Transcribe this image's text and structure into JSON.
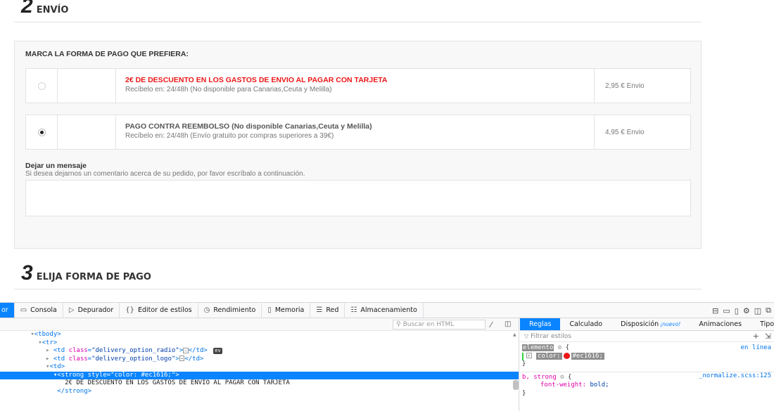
{
  "step2": {
    "number": "2",
    "title": "ENVÍO"
  },
  "shipping": {
    "heading": "MARCA LA FORMA DE PAGO QUE PREFIERA:",
    "options": [
      {
        "title": "2€ DE DESCUENTO EN LOS GASTOS DE ENVIO AL PAGAR CON TARJETA",
        "desc": "Recíbelo en: 24/48h (No disponible para Canarias,Ceuta y Melilla)",
        "price": "2,95 € Envio",
        "selected": false
      },
      {
        "title": "PAGO CONTRA REEMBOLSO (No disponible Canarias,Ceuta y Melilla)",
        "desc": "Recíbelo en: 24/48h (Envío gratuito por compras superiores a 39€)",
        "price": "4,95 € Envio",
        "selected": true
      }
    ],
    "message_label": "Dejar un mensaje",
    "message_help": "Si desea dejarnos un comentario acerca de su pedido, por favor escríbalo a continuación.",
    "message_value": ""
  },
  "step3": {
    "number": "3",
    "title": "ELIJA FORMA DE PAGO"
  },
  "devtools": {
    "tabs": [
      {
        "label": "or",
        "icon": "inspector-icon",
        "glyph": "",
        "active": true
      },
      {
        "label": "Consola",
        "icon": "console-icon",
        "glyph": "▭",
        "active": false
      },
      {
        "label": "Depurador",
        "icon": "debugger-icon",
        "glyph": "▷",
        "active": false
      },
      {
        "label": "Editor de estilos",
        "icon": "style-editor-icon",
        "glyph": "{}",
        "active": false
      },
      {
        "label": "Rendimiento",
        "icon": "performance-icon",
        "glyph": "◷",
        "active": false
      },
      {
        "label": "Memoria",
        "icon": "memory-icon",
        "glyph": "▯",
        "active": false
      },
      {
        "label": "Red",
        "icon": "network-icon",
        "glyph": "☰",
        "active": false
      },
      {
        "label": "Almacenamiento",
        "icon": "storage-icon",
        "glyph": "☷",
        "active": false
      }
    ],
    "search_placeholder": "Buscar en HTML",
    "markup_lines": [
      {
        "indent": "        ",
        "html": "<span class=\"tri\">▾</span><span class=\"tag\">&lt;tbody&gt;</span>",
        "sel": false
      },
      {
        "indent": "          ",
        "html": "<span class=\"tri\">▾</span><span class=\"tag\">&lt;tr&gt;</span>",
        "sel": false
      },
      {
        "indent": "            ",
        "html": "<span class=\"tri\">▸</span> <span class=\"tag\">&lt;td </span><span class=\"attr\">class</span><span class=\"tag\">=</span><span class=\"val\">\"delivery_option_radio\"</span><span class=\"tag\">&gt;</span><span class=\"ellipsis-box\">…</span><span class=\"tag\">&lt;/td&gt;</span> <span class=\"ev\">ev</span>",
        "sel": false
      },
      {
        "indent": "            ",
        "html": "<span class=\"tri\">▸</span> <span class=\"tag\">&lt;td </span><span class=\"attr\">class</span><span class=\"tag\">=</span><span class=\"val\">\"delivery_option_logo\"</span><span class=\"tag\">&gt;</span><span class=\"ellipsis-box\">…</span><span class=\"tag\">&lt;/td&gt;</span>",
        "sel": false
      },
      {
        "indent": "            ",
        "html": "<span class=\"tri\">▾</span><span class=\"tag\">&lt;td&gt;</span>",
        "sel": false
      },
      {
        "indent": "              ",
        "html": "<span class=\"tri\">▾</span><span class=\"tag\">&lt;strong </span><span class=\"attr\">style</span><span class=\"tag\">=</span><span class=\"val\">\"color: #ec1616;\"</span><span class=\"tag\">&gt;</span>",
        "sel": true
      },
      {
        "indent": "                 ",
        "html": "2€ DE DESCUENTO EN LOS GASTOS DE ENVIO AL PAGAR CON TARJETA",
        "sel": false
      },
      {
        "indent": "               ",
        "html": "<span class=\"tag\">&lt;/strong&gt;</span>",
        "sel": false
      }
    ],
    "rules_tabs": [
      {
        "label": "Reglas",
        "active": true,
        "new": ""
      },
      {
        "label": "Calculado",
        "active": false,
        "new": ""
      },
      {
        "label": "Disposición",
        "active": false,
        "new": "¡nuevo!"
      },
      {
        "label": "Animaciones",
        "active": false,
        "new": ""
      },
      {
        "label": "Tipogra",
        "active": false,
        "new": ""
      }
    ],
    "filter_placeholder": "Filtrar estilos",
    "element_rule": {
      "selector": "elemento",
      "source": "en línea",
      "prop": "color:",
      "value": "#ec1616;",
      "swatch": "#ec1616"
    },
    "strong_rule": {
      "selector": "b, strong",
      "source": "_normalize.scss:125",
      "prop": "font-weight:",
      "value": "bold;"
    }
  }
}
